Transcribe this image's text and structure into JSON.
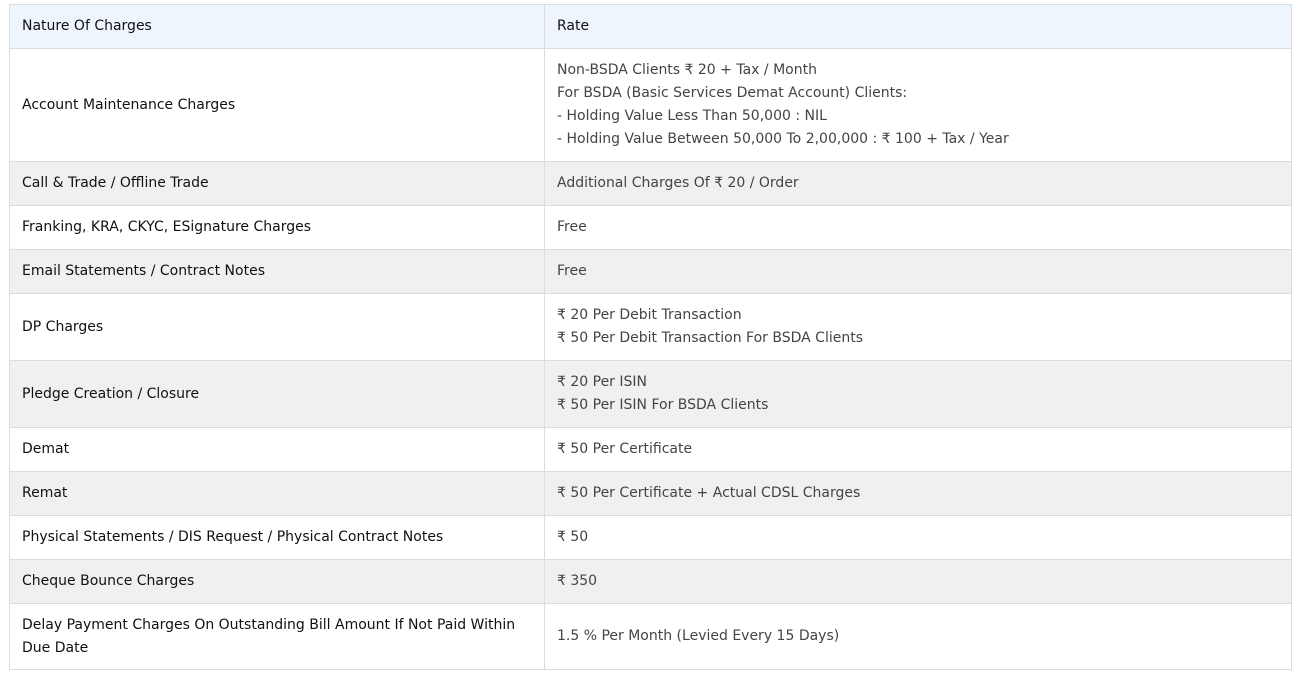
{
  "table": {
    "headers": [
      "Nature Of Charges",
      "Rate"
    ],
    "rows": [
      {
        "name": "Account Maintenance Charges",
        "rate": [
          "Non-BSDA Clients ₹ 20 + Tax / Month",
          "For BSDA (Basic Services Demat Account) Clients:",
          "- Holding Value Less Than 50,000 : NIL",
          "- Holding Value Between 50,000 To 2,00,000 : ₹ 100 + Tax / Year"
        ]
      },
      {
        "name": "Call & Trade / Offline Trade",
        "rate": [
          "Additional Charges Of ₹ 20 / Order"
        ]
      },
      {
        "name": "Franking, KRA, CKYC, ESignature Charges",
        "rate": [
          "Free"
        ]
      },
      {
        "name": "Email Statements / Contract Notes",
        "rate": [
          "Free"
        ]
      },
      {
        "name": "DP Charges",
        "rate": [
          "₹ 20 Per Debit Transaction",
          "₹ 50 Per Debit Transaction For BSDA Clients"
        ]
      },
      {
        "name": "Pledge Creation / Closure",
        "rate": [
          "₹ 20 Per ISIN",
          "₹ 50 Per ISIN For BSDA Clients"
        ]
      },
      {
        "name": "Demat",
        "rate": [
          "₹ 50 Per Certificate"
        ]
      },
      {
        "name": "Remat",
        "rate": [
          "₹ 50 Per Certificate + Actual CDSL Charges"
        ]
      },
      {
        "name": "Physical Statements / DIS Request / Physical Contract Notes",
        "rate": [
          "₹ 50"
        ]
      },
      {
        "name": "Cheque Bounce Charges",
        "rate": [
          "₹ 350"
        ]
      },
      {
        "name": "Delay Payment Charges On Outstanding Bill Amount If Not Paid Within Due Date",
        "rate": [
          "1.5 % Per Month (Levied Every 15 Days)"
        ]
      }
    ]
  },
  "colors": {
    "header_bg": "#eef5fd",
    "stripe_bg": "#f0f0f0",
    "border": "#dcdcdc"
  }
}
